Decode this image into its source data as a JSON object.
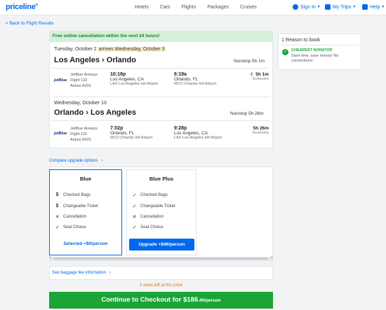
{
  "header": {
    "logo": "priceline",
    "logo_mark": "®",
    "nav": [
      "Hotels",
      "Cars",
      "Flights",
      "Packages",
      "Cruises"
    ],
    "sign_in": "Sign In",
    "my_trips": "My Trips",
    "help": "Help"
  },
  "back_link": "< Back to Flight Results",
  "banner": "Free online cancellation within the next 24 hours!",
  "outbound": {
    "date": "Tuesday, October 2",
    "arrives": "arrives Wednesday, October 3",
    "route": "Los Angeles › Orlando",
    "summary": "Nonstop  5h 1m",
    "airline": "JetBlue Airways",
    "flight": "Flight 132",
    "aircraft": "Airbus A320",
    "logo_text": "jetBlue",
    "depart_time": "10:18p",
    "depart_city": "Los Angeles, CA",
    "depart_airport": "LAX Los Angeles Intl Airport",
    "arrive_time": "6:19a",
    "arrive_city": "Orlando, FL",
    "arrive_airport": "MCO Orlando Intl Airport",
    "duration": "5h 1m",
    "cabin": "Economy"
  },
  "return": {
    "date": "Wednesday, October 10",
    "route": "Orlando › Los Angeles",
    "summary": "Nonstop  5h 26m",
    "airline": "JetBlue Airways",
    "flight": "Flight 131",
    "aircraft": "Airbus A320",
    "logo_text": "jetBlue",
    "depart_time": "7:02p",
    "depart_city": "Orlando, FL",
    "depart_airport": "MCO Orlando Intl Airport",
    "arrive_time": "9:28p",
    "arrive_city": "Los Angeles, CA",
    "arrive_airport": "LAX Los Angeles Intl Airport",
    "duration": "5h 26m",
    "cabin": "Economy"
  },
  "compare_link": "Compare upgrade options",
  "fares": {
    "blue": {
      "name": "Blue",
      "features": [
        "Checked Bags",
        "Changeable Ticket",
        "Cancellation",
        "Seat Choice"
      ],
      "action": "Selected +$0/person"
    },
    "blue_plus": {
      "name": "Blue Plus",
      "features": [
        "Checked Bags",
        "Changeable Ticket",
        "Cancellation",
        "Seat Choice"
      ],
      "action": "Upgrade +$46/person"
    }
  },
  "baggage_link": "See baggage fee information",
  "seats_left": "3 seats left at this price",
  "checkout": {
    "label": "Continue to Checkout for $186",
    "cents": ".40/person"
  },
  "reasons": {
    "title": "1 Reason to book",
    "heading": "CHEAPEST NONSTOP",
    "text": "Save time, save money! No connections!"
  },
  "colors": {
    "brand_blue": "#0068ef",
    "checkout_green": "#1aa537",
    "banner_green": "#d5f0d8",
    "seats_orange": "#e07b00"
  }
}
